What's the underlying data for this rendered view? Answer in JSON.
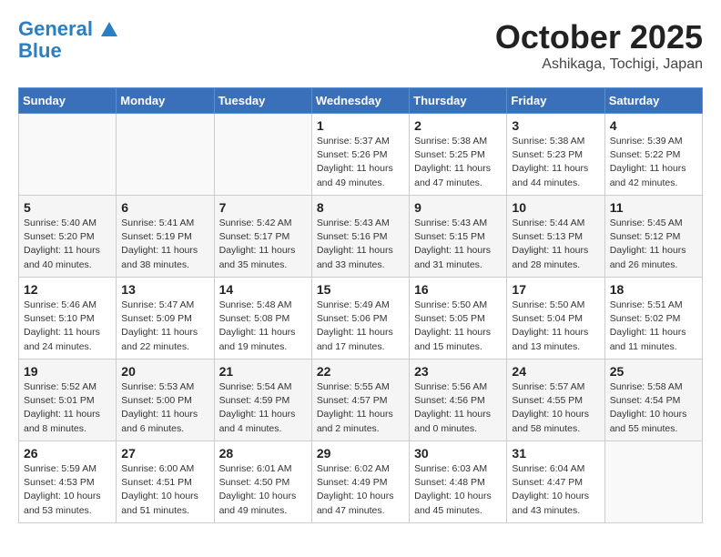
{
  "header": {
    "logo_line1": "General",
    "logo_line2": "Blue",
    "month": "October 2025",
    "location": "Ashikaga, Tochigi, Japan"
  },
  "weekdays": [
    "Sunday",
    "Monday",
    "Tuesday",
    "Wednesday",
    "Thursday",
    "Friday",
    "Saturday"
  ],
  "weeks": [
    [
      {
        "day": "",
        "sunrise": "",
        "sunset": "",
        "daylight": ""
      },
      {
        "day": "",
        "sunrise": "",
        "sunset": "",
        "daylight": ""
      },
      {
        "day": "",
        "sunrise": "",
        "sunset": "",
        "daylight": ""
      },
      {
        "day": "1",
        "sunrise": "Sunrise: 5:37 AM",
        "sunset": "Sunset: 5:26 PM",
        "daylight": "Daylight: 11 hours and 49 minutes."
      },
      {
        "day": "2",
        "sunrise": "Sunrise: 5:38 AM",
        "sunset": "Sunset: 5:25 PM",
        "daylight": "Daylight: 11 hours and 47 minutes."
      },
      {
        "day": "3",
        "sunrise": "Sunrise: 5:38 AM",
        "sunset": "Sunset: 5:23 PM",
        "daylight": "Daylight: 11 hours and 44 minutes."
      },
      {
        "day": "4",
        "sunrise": "Sunrise: 5:39 AM",
        "sunset": "Sunset: 5:22 PM",
        "daylight": "Daylight: 11 hours and 42 minutes."
      }
    ],
    [
      {
        "day": "5",
        "sunrise": "Sunrise: 5:40 AM",
        "sunset": "Sunset: 5:20 PM",
        "daylight": "Daylight: 11 hours and 40 minutes."
      },
      {
        "day": "6",
        "sunrise": "Sunrise: 5:41 AM",
        "sunset": "Sunset: 5:19 PM",
        "daylight": "Daylight: 11 hours and 38 minutes."
      },
      {
        "day": "7",
        "sunrise": "Sunrise: 5:42 AM",
        "sunset": "Sunset: 5:17 PM",
        "daylight": "Daylight: 11 hours and 35 minutes."
      },
      {
        "day": "8",
        "sunrise": "Sunrise: 5:43 AM",
        "sunset": "Sunset: 5:16 PM",
        "daylight": "Daylight: 11 hours and 33 minutes."
      },
      {
        "day": "9",
        "sunrise": "Sunrise: 5:43 AM",
        "sunset": "Sunset: 5:15 PM",
        "daylight": "Daylight: 11 hours and 31 minutes."
      },
      {
        "day": "10",
        "sunrise": "Sunrise: 5:44 AM",
        "sunset": "Sunset: 5:13 PM",
        "daylight": "Daylight: 11 hours and 28 minutes."
      },
      {
        "day": "11",
        "sunrise": "Sunrise: 5:45 AM",
        "sunset": "Sunset: 5:12 PM",
        "daylight": "Daylight: 11 hours and 26 minutes."
      }
    ],
    [
      {
        "day": "12",
        "sunrise": "Sunrise: 5:46 AM",
        "sunset": "Sunset: 5:10 PM",
        "daylight": "Daylight: 11 hours and 24 minutes."
      },
      {
        "day": "13",
        "sunrise": "Sunrise: 5:47 AM",
        "sunset": "Sunset: 5:09 PM",
        "daylight": "Daylight: 11 hours and 22 minutes."
      },
      {
        "day": "14",
        "sunrise": "Sunrise: 5:48 AM",
        "sunset": "Sunset: 5:08 PM",
        "daylight": "Daylight: 11 hours and 19 minutes."
      },
      {
        "day": "15",
        "sunrise": "Sunrise: 5:49 AM",
        "sunset": "Sunset: 5:06 PM",
        "daylight": "Daylight: 11 hours and 17 minutes."
      },
      {
        "day": "16",
        "sunrise": "Sunrise: 5:50 AM",
        "sunset": "Sunset: 5:05 PM",
        "daylight": "Daylight: 11 hours and 15 minutes."
      },
      {
        "day": "17",
        "sunrise": "Sunrise: 5:50 AM",
        "sunset": "Sunset: 5:04 PM",
        "daylight": "Daylight: 11 hours and 13 minutes."
      },
      {
        "day": "18",
        "sunrise": "Sunrise: 5:51 AM",
        "sunset": "Sunset: 5:02 PM",
        "daylight": "Daylight: 11 hours and 11 minutes."
      }
    ],
    [
      {
        "day": "19",
        "sunrise": "Sunrise: 5:52 AM",
        "sunset": "Sunset: 5:01 PM",
        "daylight": "Daylight: 11 hours and 8 minutes."
      },
      {
        "day": "20",
        "sunrise": "Sunrise: 5:53 AM",
        "sunset": "Sunset: 5:00 PM",
        "daylight": "Daylight: 11 hours and 6 minutes."
      },
      {
        "day": "21",
        "sunrise": "Sunrise: 5:54 AM",
        "sunset": "Sunset: 4:59 PM",
        "daylight": "Daylight: 11 hours and 4 minutes."
      },
      {
        "day": "22",
        "sunrise": "Sunrise: 5:55 AM",
        "sunset": "Sunset: 4:57 PM",
        "daylight": "Daylight: 11 hours and 2 minutes."
      },
      {
        "day": "23",
        "sunrise": "Sunrise: 5:56 AM",
        "sunset": "Sunset: 4:56 PM",
        "daylight": "Daylight: 11 hours and 0 minutes."
      },
      {
        "day": "24",
        "sunrise": "Sunrise: 5:57 AM",
        "sunset": "Sunset: 4:55 PM",
        "daylight": "Daylight: 10 hours and 58 minutes."
      },
      {
        "day": "25",
        "sunrise": "Sunrise: 5:58 AM",
        "sunset": "Sunset: 4:54 PM",
        "daylight": "Daylight: 10 hours and 55 minutes."
      }
    ],
    [
      {
        "day": "26",
        "sunrise": "Sunrise: 5:59 AM",
        "sunset": "Sunset: 4:53 PM",
        "daylight": "Daylight: 10 hours and 53 minutes."
      },
      {
        "day": "27",
        "sunrise": "Sunrise: 6:00 AM",
        "sunset": "Sunset: 4:51 PM",
        "daylight": "Daylight: 10 hours and 51 minutes."
      },
      {
        "day": "28",
        "sunrise": "Sunrise: 6:01 AM",
        "sunset": "Sunset: 4:50 PM",
        "daylight": "Daylight: 10 hours and 49 minutes."
      },
      {
        "day": "29",
        "sunrise": "Sunrise: 6:02 AM",
        "sunset": "Sunset: 4:49 PM",
        "daylight": "Daylight: 10 hours and 47 minutes."
      },
      {
        "day": "30",
        "sunrise": "Sunrise: 6:03 AM",
        "sunset": "Sunset: 4:48 PM",
        "daylight": "Daylight: 10 hours and 45 minutes."
      },
      {
        "day": "31",
        "sunrise": "Sunrise: 6:04 AM",
        "sunset": "Sunset: 4:47 PM",
        "daylight": "Daylight: 10 hours and 43 minutes."
      },
      {
        "day": "",
        "sunrise": "",
        "sunset": "",
        "daylight": ""
      }
    ]
  ]
}
